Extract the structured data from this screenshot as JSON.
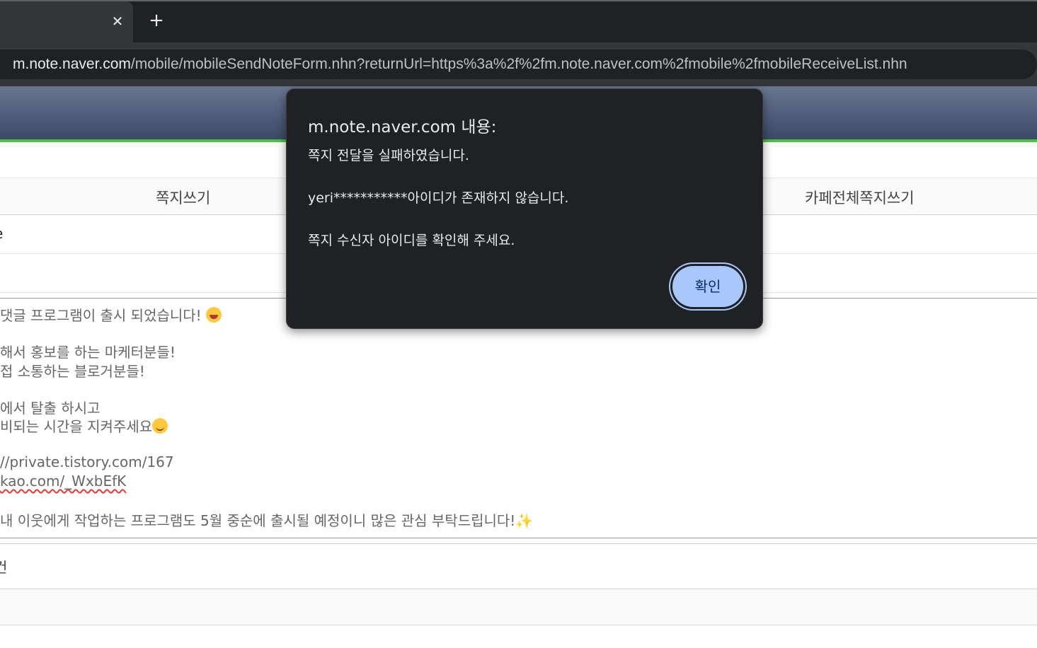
{
  "browser": {
    "tab_close_glyph": "✕",
    "new_tab_glyph": "+",
    "url_host": "m.note.naver.com",
    "url_rest": "/mobile/mobileSendNoteForm.nhn?returnUrl=https%3a%2f%2fm.note.naver.com%2fmobile%2fmobileReceiveList.nhn"
  },
  "page": {
    "tabs": [
      "쪽지쓰기",
      "카페전체쪽지쓰기"
    ],
    "recipient_partial": "e",
    "body_lines": [
      "댓글 프로그램이 출시 되었습니다!",
      "",
      " 해서 홍보를 하는 마케터분들!",
      "접 소통하는 블로거분들!",
      "",
      "에서 탈출 하시고",
      "비되는 시간을 지켜주세요",
      "",
      "//private.tistory.com/167",
      "kao.com/_WxbEfK",
      "",
      " 내 이웃에게 작업하는 프로그램도 5월 중순에 출시될 예정이니 많은 관심 부탁드립니다!"
    ],
    "attach_partial": "건"
  },
  "dialog": {
    "title": "m.note.naver.com 내용:",
    "line1": "쪽지 전달을 실패하였습니다.",
    "line2": "yeri***********아이디가 존재하지 않습니다.",
    "line3": "쪽지 수신자 아이디를 확인해 주세요.",
    "ok_label": "확인"
  }
}
